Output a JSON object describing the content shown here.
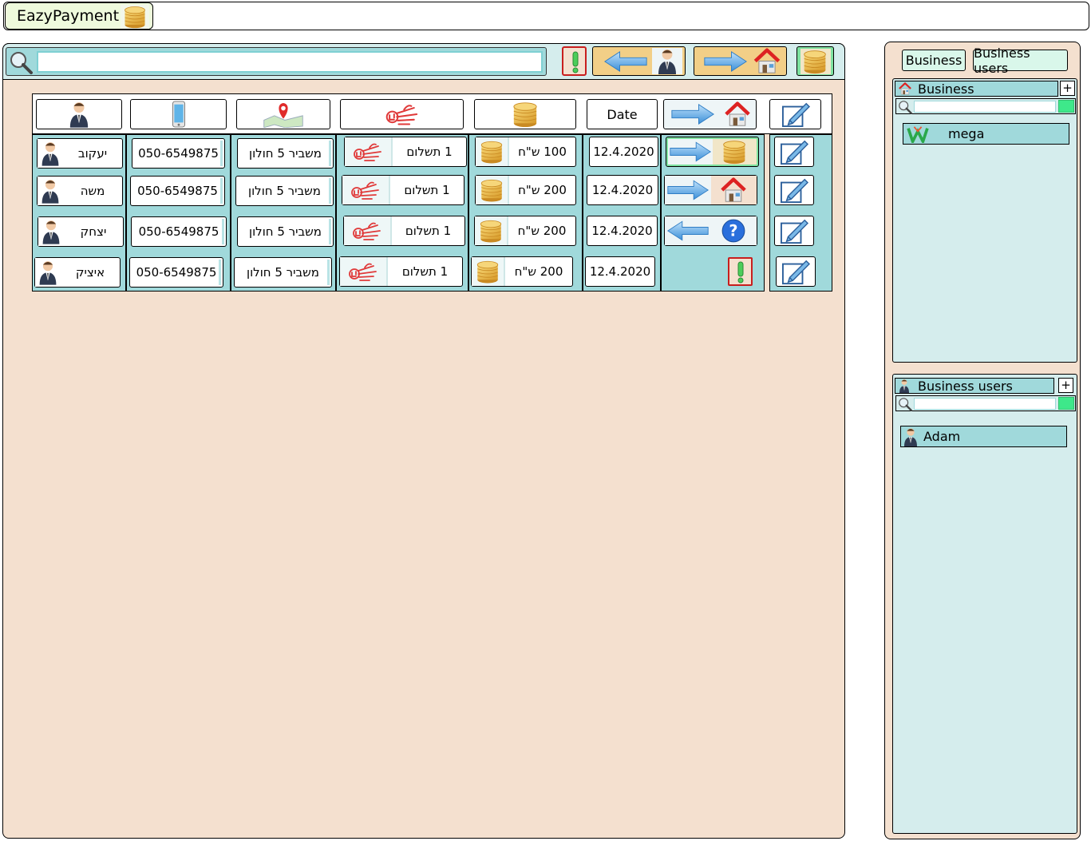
{
  "app": {
    "title": "EazyPayment"
  },
  "toolbar": {
    "search_placeholder": ""
  },
  "table": {
    "headers": {
      "date": "Date"
    },
    "rows": [
      {
        "name": "יעקוב",
        "phone": "050-6549875",
        "address": "משביר 5 חולון",
        "payments": "1 תשלום",
        "amount": "100 ש\"ח",
        "date": "12.4.2020",
        "status": "forward-coins"
      },
      {
        "name": "משה",
        "phone": "050-6549875",
        "address": "משביר 5 חולון",
        "payments": "1 תשלום",
        "amount": "200 ש\"ח",
        "date": "12.4.2020",
        "status": "forward-home"
      },
      {
        "name": "יצחק",
        "phone": "050-6549875",
        "address": "משביר 5 חולון",
        "payments": "1 תשלום",
        "amount": "200 ש\"ח",
        "date": "12.4.2020",
        "status": "back-question"
      },
      {
        "name": "איציק",
        "phone": "050-6549875",
        "address": "משביר 5 חולון",
        "payments": "1 תשלום",
        "amount": "200 ש\"ח",
        "date": "12.4.2020",
        "status": "alert"
      }
    ]
  },
  "sidebar": {
    "tabs": [
      "Business",
      "Business users"
    ],
    "business": {
      "title": "Business",
      "plus": "+",
      "items": [
        "mega"
      ]
    },
    "business_users": {
      "title": "Business users",
      "plus": "+",
      "items": [
        "Adam"
      ]
    }
  },
  "colors": {
    "panel": "#f4e0cf",
    "accent": "#a0d9db",
    "light": "#d5eded",
    "orange": "#f2cf87",
    "green": "#7ee2a0",
    "alert": "#c81e1e"
  }
}
